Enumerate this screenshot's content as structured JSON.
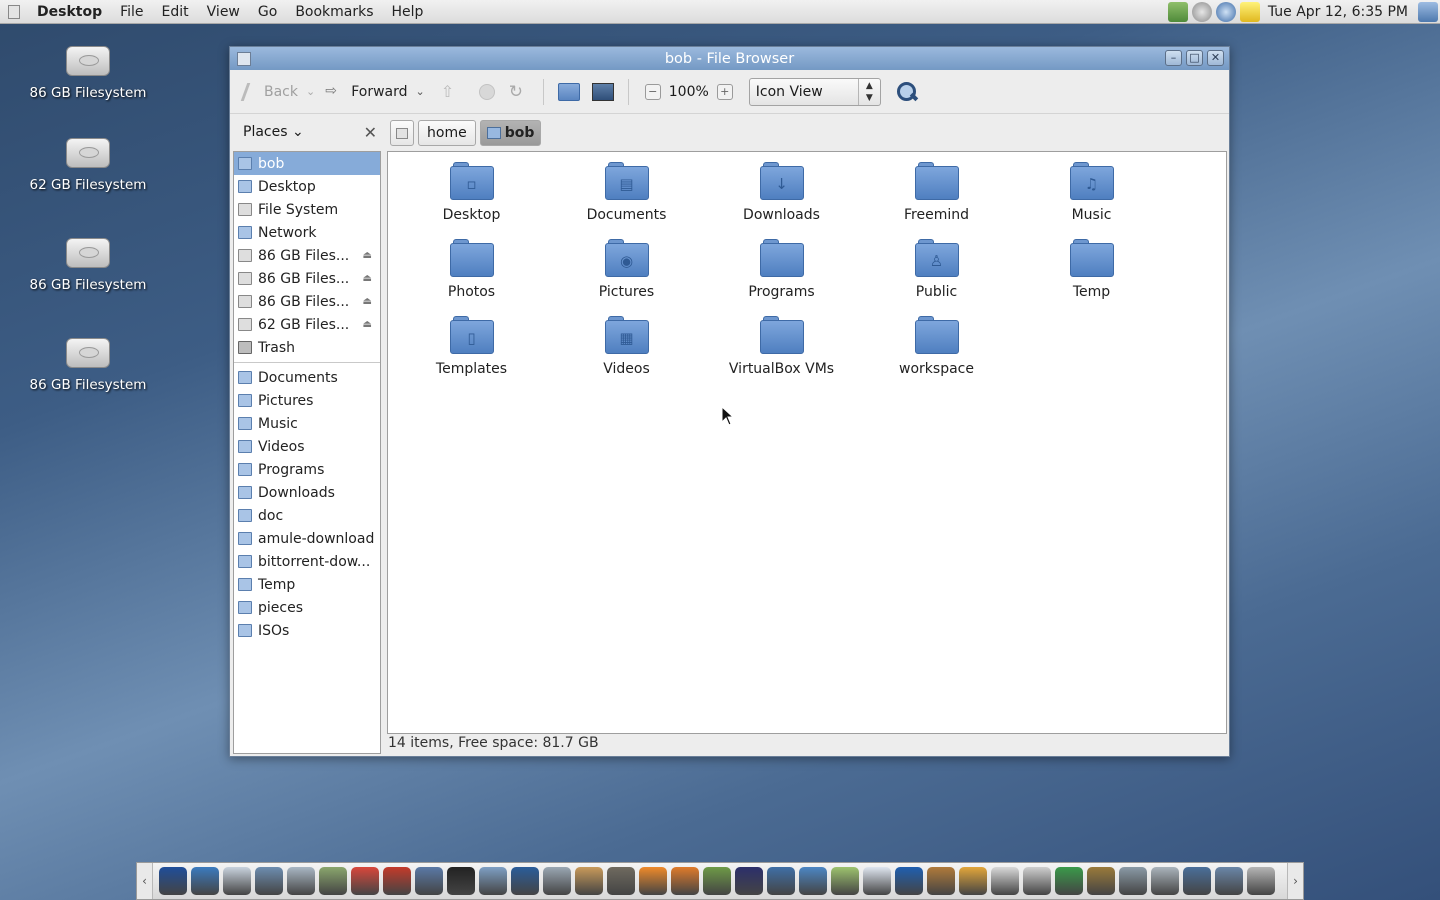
{
  "top_panel": {
    "menus": [
      "Desktop",
      "File",
      "Edit",
      "View",
      "Go",
      "Bookmarks",
      "Help"
    ],
    "clock": "Tue Apr 12,  6:35 PM",
    "tray_icons": [
      "network-icon",
      "settings-icon",
      "update-icon",
      "notes-icon"
    ]
  },
  "desktop_icons": [
    {
      "label": "86 GB Filesystem"
    },
    {
      "label": "62 GB Filesystem"
    },
    {
      "label": "86 GB Filesystem"
    },
    {
      "label": "86 GB Filesystem"
    }
  ],
  "window": {
    "title": "bob - File Browser",
    "toolbar": {
      "back": "Back",
      "forward": "Forward",
      "zoom": "100%",
      "view_mode": "Icon View"
    },
    "sidebar": {
      "header": "Places",
      "places": [
        {
          "label": "bob",
          "icon": "home-folder-icon",
          "selected": true
        },
        {
          "label": "Desktop",
          "icon": "desktop-folder-icon"
        },
        {
          "label": "File System",
          "icon": "drive-icon"
        },
        {
          "label": "Network",
          "icon": "network-folder-icon"
        },
        {
          "label": "86 GB Files...",
          "icon": "drive-icon",
          "eject": true
        },
        {
          "label": "86 GB Files...",
          "icon": "drive-icon",
          "eject": true
        },
        {
          "label": "86 GB Files...",
          "icon": "drive-icon",
          "eject": true
        },
        {
          "label": "62 GB Files...",
          "icon": "drive-icon",
          "eject": true
        },
        {
          "label": "Trash",
          "icon": "trash-icon"
        }
      ],
      "bookmarks": [
        {
          "label": "Documents"
        },
        {
          "label": "Pictures"
        },
        {
          "label": "Music"
        },
        {
          "label": "Videos"
        },
        {
          "label": "Programs"
        },
        {
          "label": "Downloads"
        },
        {
          "label": "doc"
        },
        {
          "label": "amule-download"
        },
        {
          "label": "bittorrent-dow..."
        },
        {
          "label": "Temp"
        },
        {
          "label": "pieces"
        },
        {
          "label": "ISOs"
        }
      ]
    },
    "pathbar": [
      "home",
      "bob"
    ],
    "files": [
      {
        "name": "Desktop",
        "glyph": "▫"
      },
      {
        "name": "Documents",
        "glyph": "▤"
      },
      {
        "name": "Downloads",
        "glyph": "↓"
      },
      {
        "name": "Freemind",
        "glyph": ""
      },
      {
        "name": "Music",
        "glyph": "♫"
      },
      {
        "name": "Photos",
        "glyph": ""
      },
      {
        "name": "Pictures",
        "glyph": "◉"
      },
      {
        "name": "Programs",
        "glyph": ""
      },
      {
        "name": "Public",
        "glyph": "♙"
      },
      {
        "name": "Temp",
        "glyph": ""
      },
      {
        "name": "Templates",
        "glyph": "▯"
      },
      {
        "name": "Videos",
        "glyph": "▦"
      },
      {
        "name": "VirtualBox VMs",
        "glyph": ""
      },
      {
        "name": "workspace",
        "glyph": ""
      }
    ],
    "status": "14 items, Free space: 81.7 GB"
  },
  "dock": {
    "icons": [
      {
        "name": "fedora-icon",
        "color": "#1f4e9a"
      },
      {
        "name": "browser-globe-icon",
        "color": "#3b7bbf"
      },
      {
        "name": "clock-icon",
        "color": "#c9d3de"
      },
      {
        "name": "network-tools-icon",
        "color": "#6d8db0"
      },
      {
        "name": "disk-utility-icon",
        "color": "#a9b7c4"
      },
      {
        "name": "spreadsheet-icon",
        "color": "#8aa66d"
      },
      {
        "name": "chart-icon",
        "color": "#d9473b"
      },
      {
        "name": "text-editor-icon",
        "color": "#c43a2a"
      },
      {
        "name": "drawing-icon",
        "color": "#5a79a6"
      },
      {
        "name": "inkscape-icon",
        "color": "#222222"
      },
      {
        "name": "network-icon",
        "color": "#7e9fc4"
      },
      {
        "name": "image-viewer-icon",
        "color": "#2a5d9a"
      },
      {
        "name": "magnifier-icon",
        "color": "#9aa7b3"
      },
      {
        "name": "photos-icon",
        "color": "#c99a5a"
      },
      {
        "name": "gimp-icon",
        "color": "#6f6a5f"
      },
      {
        "name": "blender-icon",
        "color": "#ef8a2a"
      },
      {
        "name": "shell-icon",
        "color": "#e07b2a"
      },
      {
        "name": "finance-icon",
        "color": "#6e9a46"
      },
      {
        "name": "eclipse-icon",
        "color": "#2c2f6b"
      },
      {
        "name": "fish-icon",
        "color": "#3f6fa6"
      },
      {
        "name": "balloons-icon",
        "color": "#4c86c4"
      },
      {
        "name": "sparkle-icon",
        "color": "#9dc36e"
      },
      {
        "name": "notes-icon",
        "color": "#dfe6f0"
      },
      {
        "name": "chat-icon",
        "color": "#1f5fb0"
      },
      {
        "name": "mule-icon",
        "color": "#b07a3a"
      },
      {
        "name": "star-icon",
        "color": "#e3a63a"
      },
      {
        "name": "messages-icon",
        "color": "#d9d9d9"
      },
      {
        "name": "disc-icon",
        "color": "#cfcfcf"
      },
      {
        "name": "exit-icon",
        "color": "#3a9a4a"
      },
      {
        "name": "tools-icon",
        "color": "#9a7a3a"
      },
      {
        "name": "network-manager-icon",
        "color": "#8a9aa6"
      },
      {
        "name": "volume-icon",
        "color": "#aab4bc"
      },
      {
        "name": "monitors-icon",
        "color": "#4a6f9a"
      },
      {
        "name": "workspace-switcher-icon",
        "color": "#6a86a8"
      },
      {
        "name": "trash-icon",
        "color": "#b5b5b5"
      }
    ]
  }
}
